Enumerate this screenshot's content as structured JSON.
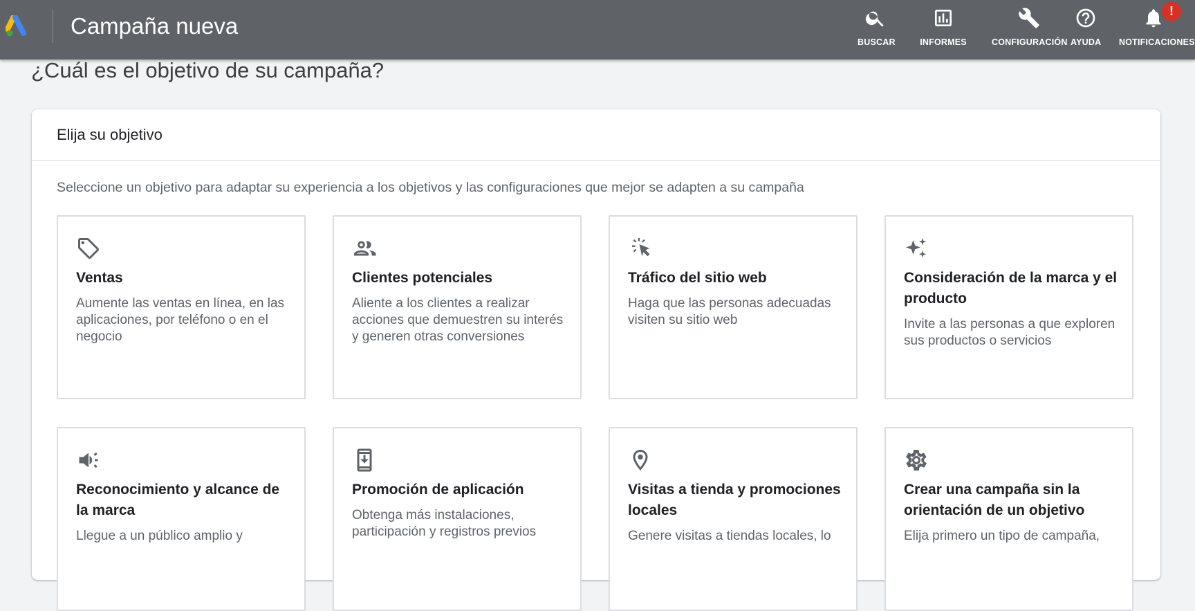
{
  "header": {
    "title": "Campaña nueva",
    "actions": [
      {
        "label": "BUSCAR",
        "icon": "search-icon"
      },
      {
        "label": "INFORMES",
        "icon": "bar-chart-icon"
      },
      {
        "label": "CONFIGURACIÓN",
        "icon": "wrench-icon"
      },
      {
        "label": "AYUDA",
        "icon": "help-icon"
      },
      {
        "label": "NOTIFICACIONES",
        "icon": "bell-icon",
        "badge": "!"
      }
    ]
  },
  "page": {
    "title": "¿Cuál es el objetivo de su campaña?"
  },
  "card": {
    "title": "Elija su objetivo",
    "description": "Seleccione un objetivo para adaptar su experiencia a los objetivos y las configuraciones que mejor se adapten a su campaña",
    "goals": [
      {
        "icon": "tag-icon",
        "title": "Ventas",
        "description": "Aumente las ventas en línea, en las aplicaciones, por teléfono o en el negocio"
      },
      {
        "icon": "people-icon",
        "title": "Clientes potenciales",
        "description": "Aliente a los clientes a realizar acciones que demuestren su interés y generen otras conversiones"
      },
      {
        "icon": "cursor-click-icon",
        "title": "Tráfico del sitio web",
        "description": "Haga que las personas adecuadas visiten su sitio web"
      },
      {
        "icon": "sparkle-icon",
        "title": "Consideración de la marca y el producto",
        "description": "Invite a las personas a que exploren sus productos o servicios"
      },
      {
        "icon": "megaphone-icon",
        "title": "Reconocimiento y alcance de la marca",
        "description": "Llegue a un público amplio y"
      },
      {
        "icon": "phone-download-icon",
        "title": "Promoción de aplicación",
        "description": "Obtenga más instalaciones, participación y registros previos"
      },
      {
        "icon": "location-pin-icon",
        "title": "Visitas a tienda y promociones locales",
        "description": "Genere visitas a tiendas locales, lo"
      },
      {
        "icon": "gear-icon",
        "title": "Crear una campaña sin la orientación de un objetivo",
        "description": "Elija primero un tipo de campaña,"
      }
    ]
  },
  "colors": {
    "header_bg": "#5f6368",
    "page_bg": "#f1f3f4",
    "badge": "#d93025",
    "logo_blue": "#4285f4",
    "logo_yellow": "#fbbc04",
    "logo_green": "#34a853"
  }
}
